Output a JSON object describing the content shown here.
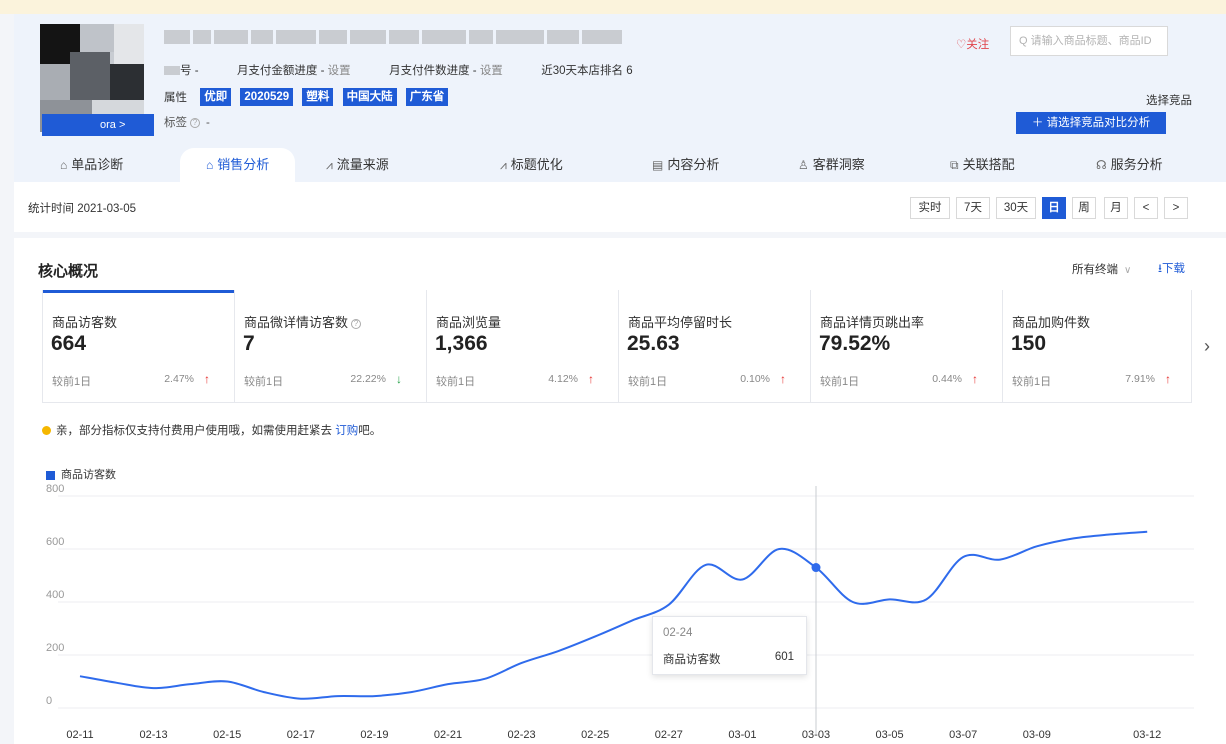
{
  "product": {
    "shop_button": "ora >",
    "row1": {
      "prefix": "号 -",
      "amount_progress_label": "月支付金额进度 -",
      "amount_progress_action": "设置",
      "count_progress_label": "月支付件数进度 -",
      "count_progress_action": "设置",
      "rank": "近30天本店排名 6"
    },
    "attributes_label": "属性",
    "attributes": [
      "优即",
      "2020529",
      "塑料",
      "中国大陆",
      "广东省"
    ],
    "labels_label": "标签",
    "labels_value": "-"
  },
  "actions": {
    "follow": "♡关注",
    "search_placeholder": "Q  请输入商品标题、商品ID",
    "select_competitor": "选择竞品",
    "compare_button": "＋ 请选择竞品对比分析"
  },
  "tabs": [
    {
      "label": "单品诊断",
      "icon": "⌂"
    },
    {
      "label": "销售分析",
      "icon": "⌂"
    },
    {
      "label": "流量来源",
      "icon": "⩘"
    },
    {
      "label": "标题优化",
      "icon": "⩘"
    },
    {
      "label": "内容分析",
      "icon": "▤"
    },
    {
      "label": "客群洞察",
      "icon": "♙"
    },
    {
      "label": "关联搭配",
      "icon": "⧉"
    },
    {
      "label": "服务分析",
      "icon": "☊"
    }
  ],
  "stat_date": "统计时间 2021-03-05",
  "periods": [
    "实时",
    "7天",
    "30天",
    "日",
    "周",
    "月",
    "<",
    ">"
  ],
  "core": {
    "title": "核心概况",
    "terminal": "所有终端",
    "download": "⭳下载"
  },
  "metrics": [
    {
      "name": "商品访客数",
      "value": "664",
      "compare": "较前1日",
      "change": "2.47%",
      "direction": "up"
    },
    {
      "name": "商品微详情访客数",
      "value": "7",
      "compare": "较前1日",
      "change": "22.22%",
      "direction": "down"
    },
    {
      "name": "商品浏览量",
      "value": "1,366",
      "compare": "较前1日",
      "change": "4.12%",
      "direction": "up"
    },
    {
      "name": "商品平均停留时长",
      "value": "25.63",
      "compare": "较前1日",
      "change": "0.10%",
      "direction": "up"
    },
    {
      "name": "商品详情页跳出率",
      "value": "79.52%",
      "compare": "较前1日",
      "change": "0.44%",
      "direction": "up"
    },
    {
      "name": "商品加购件数",
      "value": "150",
      "compare": "较前1日",
      "change": "7.91%",
      "direction": "up"
    }
  ],
  "notice": {
    "text": "亲，部分指标仅支持付费用户使用哦，如需使用赶紧去 ",
    "link": "订购",
    "suffix": "吧。"
  },
  "chart_data": {
    "type": "line",
    "series": [
      {
        "name": "商品访客数",
        "color": "#2f6bec"
      }
    ],
    "x": [
      "02-11",
      "02-12",
      "02-13",
      "02-14",
      "02-15",
      "02-16",
      "02-17",
      "02-18",
      "02-19",
      "02-20",
      "02-21",
      "02-22",
      "02-23",
      "02-24",
      "02-25",
      "02-26",
      "02-27",
      "02-28",
      "03-01",
      "03-02",
      "03-03",
      "03-04",
      "03-05",
      "03-06",
      "03-07",
      "03-08",
      "03-09",
      "03-10",
      "03-11",
      "03-12"
    ],
    "values": [
      120,
      95,
      75,
      90,
      100,
      60,
      35,
      45,
      45,
      60,
      90,
      110,
      170,
      215,
      270,
      330,
      390,
      540,
      485,
      600,
      530,
      400,
      410,
      410,
      570,
      560,
      610,
      640,
      655,
      665
    ],
    "tick_labels": [
      "02-11",
      "02-13",
      "02-15",
      "02-17",
      "02-19",
      "02-21",
      "02-23",
      "02-25",
      "02-27",
      "03-01",
      "03-03",
      "03-05",
      "03-07",
      "03-09",
      "03-12"
    ],
    "y_ticks": [
      0,
      200,
      400,
      600,
      800
    ],
    "ylim": [
      0,
      800
    ],
    "legend": "top-left",
    "grid": true,
    "highlight": {
      "date": "02-24",
      "label": "商品访客数",
      "value": "601"
    }
  }
}
